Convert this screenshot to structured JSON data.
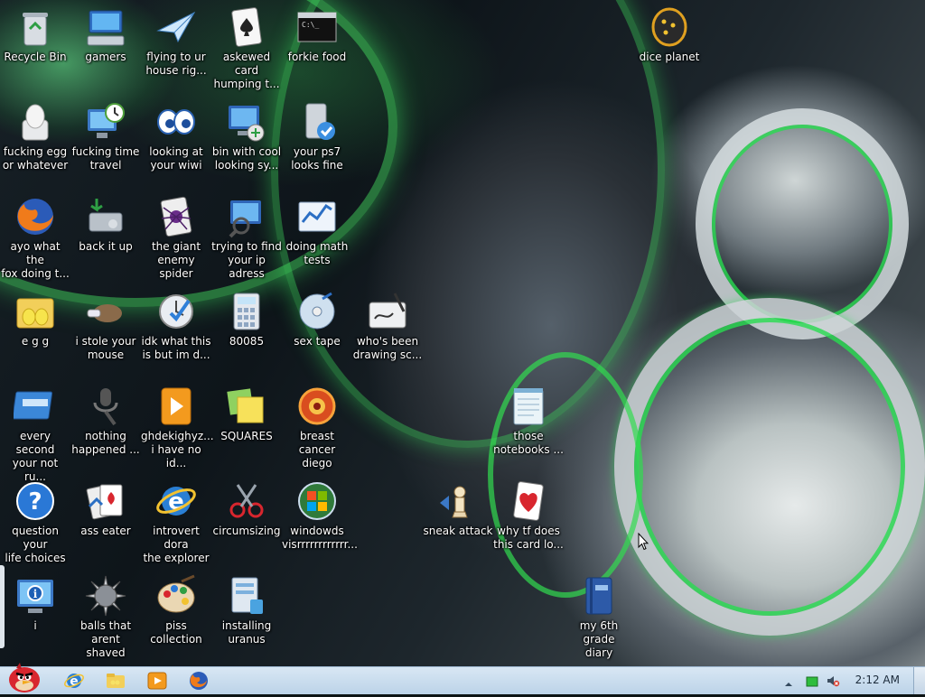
{
  "desktop": {
    "icons": [
      {
        "label": "Recycle Bin",
        "icon": "recycle-bin-icon"
      },
      {
        "label": "gamers",
        "icon": "computer-keyboard-icon"
      },
      {
        "label": "flying to ur\nhouse rig...",
        "icon": "paper-plane-icon"
      },
      {
        "label": "askewed card\nhumping t...",
        "icon": "spade-card-icon"
      },
      {
        "label": "forkie food",
        "icon": "command-prompt-icon"
      },
      {
        "label": "dice planet",
        "icon": "dice-icon"
      },
      {
        "label": "fucking egg\nor whatever",
        "icon": "egg-icon"
      },
      {
        "label": "fucking time\ntravel",
        "icon": "clock-monitor-icon"
      },
      {
        "label": "looking at\nyour wiwi",
        "icon": "eyes-icon"
      },
      {
        "label": "bin with cool\nlooking sy...",
        "icon": "network-monitor-icon"
      },
      {
        "label": "your ps7\nlooks fine",
        "icon": "drive-check-icon"
      },
      {
        "label": "ayo what the\nfox doing t...",
        "icon": "firefox-icon"
      },
      {
        "label": "back it up",
        "icon": "backup-icon"
      },
      {
        "label": "the giant\nenemy spider",
        "icon": "spider-card-icon"
      },
      {
        "label": "trying to find\nyour ip adress",
        "icon": "network-search-icon"
      },
      {
        "label": "doing math\ntests",
        "icon": "chart-icon"
      },
      {
        "label": "e g g",
        "icon": "egg-folder-icon"
      },
      {
        "label": "i stole your\nmouse",
        "icon": "hand-mouse-icon"
      },
      {
        "label": "idk what this\nis but im d...",
        "icon": "clock-check-icon"
      },
      {
        "label": "80085",
        "icon": "calculator-icon"
      },
      {
        "label": "sex tape",
        "icon": "dvd-icon"
      },
      {
        "label": "who's been\ndrawing sc...",
        "icon": "pen-tablet-icon"
      },
      {
        "label": "every second\nyour not ru...",
        "icon": "window-icon"
      },
      {
        "label": "nothing\nhappened ...",
        "icon": "microphone-icon"
      },
      {
        "label": "ghdekighyz...\ni have no id...",
        "icon": "media-player-icon"
      },
      {
        "label": "SQUARES",
        "icon": "sticky-notes-icon"
      },
      {
        "label": "breast cancer\ndiego",
        "icon": "media-center-icon"
      },
      {
        "label": "those\nnotebooks ...",
        "icon": "notepad-icon"
      },
      {
        "label": "question your\nlife choices",
        "icon": "help-icon"
      },
      {
        "label": "ass eater",
        "icon": "puzzle-cards-icon"
      },
      {
        "label": "introvert dora\nthe explorer",
        "icon": "internet-explorer-icon"
      },
      {
        "label": "circumsizing",
        "icon": "scissors-icon"
      },
      {
        "label": "windowds\nvisrrrrrrrrrrrr...",
        "icon": "windows-orb-icon"
      },
      {
        "label": "sneak attack",
        "icon": "chess-icon"
      },
      {
        "label": "why tf does\nthis card lo...",
        "icon": "heart-card-icon"
      },
      {
        "label": "i",
        "icon": "info-monitor-icon"
      },
      {
        "label": "balls that\narent shaved",
        "icon": "spiked-ball-icon"
      },
      {
        "label": "piss\ncollection",
        "icon": "paint-palette-icon"
      },
      {
        "label": "installing\nuranus",
        "icon": "installer-icon"
      },
      {
        "label": "my 6th grade\ndiary",
        "icon": "journal-icon"
      }
    ]
  },
  "taskbar": {
    "start_icon": "angry-bird-start-icon",
    "pinned": [
      {
        "name": "internet-explorer-taskbar-icon"
      },
      {
        "name": "folder-taskbar-icon"
      },
      {
        "name": "media-player-taskbar-icon"
      },
      {
        "name": "firefox-taskbar-icon"
      }
    ],
    "tray": {
      "clock": "2:12 AM"
    }
  },
  "colors": {
    "taskbar_top": "#d8e7f4",
    "taskbar_bottom": "#bcd3e8",
    "wallpaper_accent": "#2ee860"
  }
}
